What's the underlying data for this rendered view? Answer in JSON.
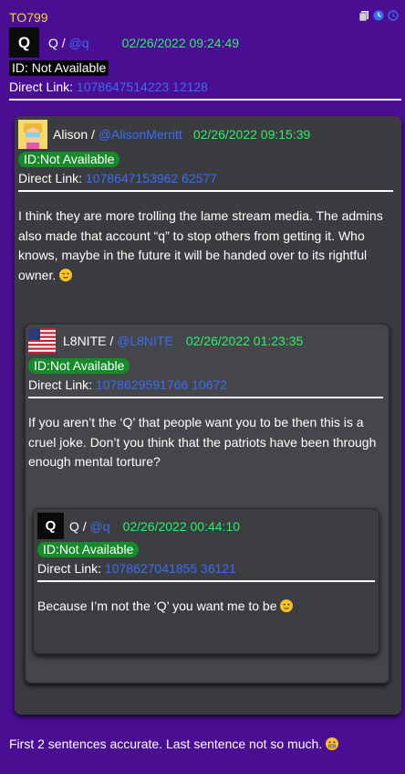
{
  "header": {
    "id_code": "TO799",
    "author": "Q",
    "handle": "@q",
    "date": "02/26/2022 09:24:49",
    "id_label": "ID: Not Available",
    "link_label": "Direct Link:",
    "link_value": "1078647514223 12128"
  },
  "posts": [
    {
      "author": "Alison",
      "handle": "@AlisonMerritt",
      "date": "02/26/2022 09:15:39",
      "id_label": "ID:Not Available",
      "link_label": "Direct Link:",
      "link_value": "1078647153962 62577",
      "text": "I think they are more trolling the lame stream media. The admins also made that account “q” to stop others from getting it. Who knows, maybe in the future it will be handed over to its rightful owner."
    },
    {
      "author": "L8NITE",
      "handle": "@L8NITE",
      "date": "02/26/2022 01:23:35",
      "id_label": "ID:Not Available",
      "link_label": "Direct Link:",
      "link_value": "1078629591766 10672",
      "text": "If you aren’t the ‘Q’ that people want you to be then this is a cruel joke. Don’t you think that the patriots have been through enough mental torture?"
    },
    {
      "author": "Q",
      "handle": "@q",
      "date": "02/26/2022 00:44:10",
      "id_label": "ID:Not Available",
      "link_label": "Direct Link:",
      "link_value": "1078627041855 36121",
      "text": "Because I’m not the ‘Q’ you want me to be"
    }
  ],
  "footer": {
    "text": "First 2 sentences accurate. Last sentence not so much."
  },
  "icons": [
    "copy-icon",
    "clock-icon",
    "history-icon",
    "wink-emoji",
    "grimace-emoji"
  ],
  "colors": {
    "background": "#4a0e92",
    "accent_yellow": "#f4d33a",
    "link_blue": "#3b6df0",
    "date_green": "#2fef6a",
    "id_pill_green": "#178a2b",
    "card": "#3b3c3f"
  }
}
